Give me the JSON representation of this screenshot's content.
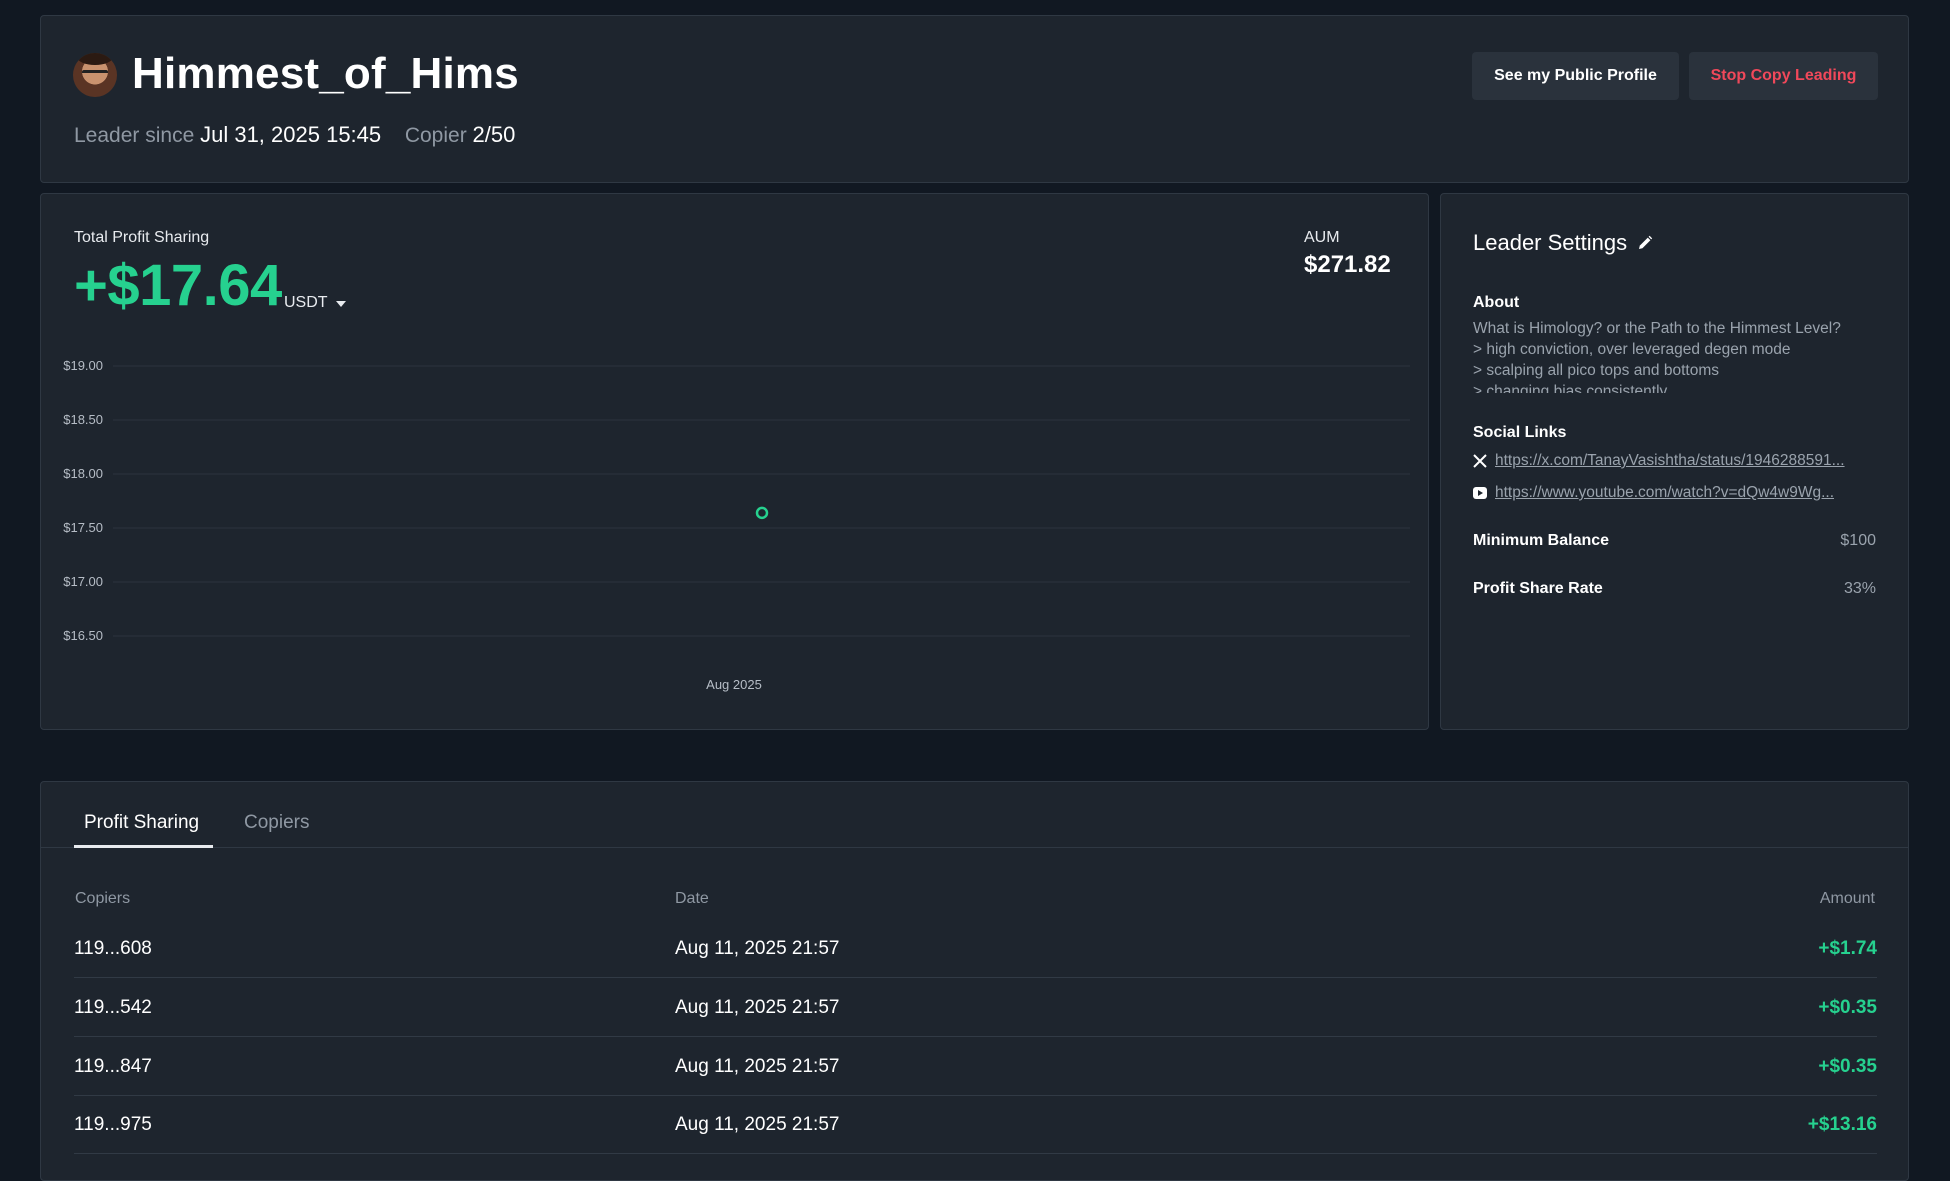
{
  "header": {
    "username": "Himmest_of_Hims",
    "leader_since_label": "Leader since",
    "leader_since_value": "Jul 31, 2025 15:45",
    "copier_label": "Copier",
    "copier_value": "2/50",
    "public_profile_button": "See my Public Profile",
    "stop_button": "Stop Copy Leading",
    "stop_button_color": "#f0485a"
  },
  "profit": {
    "label": "Total Profit Sharing",
    "value": "+$17.64",
    "currency": "USDT",
    "aum_label": "AUM",
    "aum_value": "$271.82",
    "accent_color": "#26d18f"
  },
  "chart_data": {
    "type": "scatter",
    "y_ticks": [
      "$19.00",
      "$18.50",
      "$18.00",
      "$17.50",
      "$17.00",
      "$16.50"
    ],
    "ylim": [
      16.5,
      19.0
    ],
    "x_tick_labels": [
      "Aug 2025"
    ],
    "points": [
      {
        "x": "Aug 2025",
        "y": 17.64
      }
    ],
    "grid": true
  },
  "settings": {
    "title": "Leader Settings",
    "about_label": "About",
    "about_lines": [
      "What is Himology? or the Path to the Himmest Level?",
      "> high conviction, over leveraged degen mode",
      "> scalping all pico tops and bottoms",
      "> changing bias consistently"
    ],
    "social_label": "Social Links",
    "social_links": [
      {
        "icon": "x-icon",
        "url": "https://x.com/TanayVasishtha/status/1946288591..."
      },
      {
        "icon": "youtube-icon",
        "url": "https://www.youtube.com/watch?v=dQw4w9Wg..."
      }
    ],
    "min_balance_label": "Minimum Balance",
    "min_balance_value": "$100",
    "profit_share_label": "Profit Share Rate",
    "profit_share_value": "33%"
  },
  "table": {
    "tabs": [
      "Profit Sharing",
      "Copiers"
    ],
    "active_tab": "Profit Sharing",
    "columns": [
      "Copiers",
      "Date",
      "Amount"
    ],
    "rows": [
      {
        "copier": "119...608",
        "date": "Aug 11, 2025 21:57",
        "amount": "+$1.74"
      },
      {
        "copier": "119...542",
        "date": "Aug 11, 2025 21:57",
        "amount": "+$0.35"
      },
      {
        "copier": "119...847",
        "date": "Aug 11, 2025 21:57",
        "amount": "+$0.35"
      },
      {
        "copier": "119...975",
        "date": "Aug 11, 2025 21:57",
        "amount": "+$13.16"
      }
    ]
  }
}
